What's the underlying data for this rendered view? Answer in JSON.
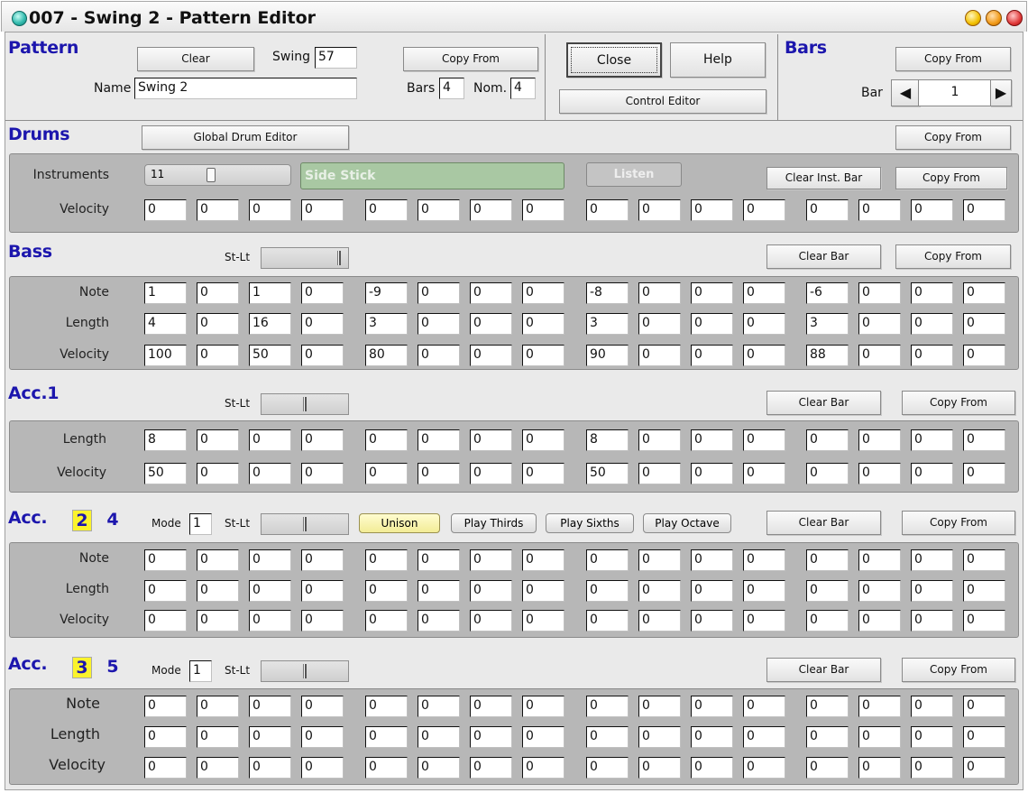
{
  "window": {
    "title": "007 - Swing 2 - Pattern Editor"
  },
  "pattern": {
    "heading": "Pattern",
    "clear": "Clear",
    "swing_label": "Swing",
    "swing_value": "57",
    "copy_from": "Copy From",
    "name_label": "Name",
    "name_value": "Swing 2",
    "bars_label": "Bars",
    "bars_value": "4",
    "nom_label": "Nom.",
    "nom_value": "4"
  },
  "controls": {
    "close": "Close",
    "help": "Help",
    "control_editor": "Control Editor"
  },
  "bars": {
    "heading": "Bars",
    "copy_from": "Copy From",
    "bar_label": "Bar",
    "bar_value": "1"
  },
  "drums": {
    "heading": "Drums",
    "global": "Global Drum Editor",
    "copy_from": "Copy From",
    "instruments_label": "Instruments",
    "instrument_num": "11",
    "instrument_name": "Side Stick",
    "listen": "Listen",
    "clear_inst": "Clear Inst. Bar",
    "copy_from2": "Copy From",
    "velocity_label": "Velocity",
    "velocity": [
      "0",
      "0",
      "0",
      "0",
      "0",
      "0",
      "0",
      "0",
      "0",
      "0",
      "0",
      "0",
      "0",
      "0",
      "0",
      "0"
    ]
  },
  "bass": {
    "heading": "Bass",
    "stlt": "St-Lt",
    "clear_bar": "Clear Bar",
    "copy_from": "Copy From",
    "note_label": "Note",
    "length_label": "Length",
    "velocity_label": "Velocity",
    "note": [
      "1",
      "0",
      "1",
      "0",
      "-9",
      "0",
      "0",
      "0",
      "-8",
      "0",
      "0",
      "0",
      "-6",
      "0",
      "0",
      "0"
    ],
    "length": [
      "4",
      "0",
      "16",
      "0",
      "3",
      "0",
      "0",
      "0",
      "3",
      "0",
      "0",
      "0",
      "3",
      "0",
      "0",
      "0"
    ],
    "velocity": [
      "100",
      "0",
      "50",
      "0",
      "80",
      "0",
      "0",
      "0",
      "90",
      "0",
      "0",
      "0",
      "88",
      "0",
      "0",
      "0"
    ]
  },
  "acc1": {
    "heading": "Acc.1",
    "stlt": "St-Lt",
    "clear_bar": "Clear Bar",
    "copy_from": "Copy From",
    "length_label": "Length",
    "velocity_label": "Velocity",
    "length": [
      "8",
      "0",
      "0",
      "0",
      "0",
      "0",
      "0",
      "0",
      "8",
      "0",
      "0",
      "0",
      "0",
      "0",
      "0",
      "0"
    ],
    "velocity": [
      "50",
      "0",
      "0",
      "0",
      "0",
      "0",
      "0",
      "0",
      "50",
      "0",
      "0",
      "0",
      "0",
      "0",
      "0",
      "0"
    ]
  },
  "acc24": {
    "heading": "Acc.",
    "num_a": "2",
    "num_b": "4",
    "mode_label": "Mode",
    "mode_value": "1",
    "stlt": "St-Lt",
    "unison": "Unison",
    "thirds": "Play Thirds",
    "sixths": "Play Sixths",
    "octave": "Play Octave",
    "clear_bar": "Clear Bar",
    "copy_from": "Copy From",
    "note_label": "Note",
    "length_label": "Length",
    "velocity_label": "Velocity",
    "note": [
      "0",
      "0",
      "0",
      "0",
      "0",
      "0",
      "0",
      "0",
      "0",
      "0",
      "0",
      "0",
      "0",
      "0",
      "0",
      "0"
    ],
    "length": [
      "0",
      "0",
      "0",
      "0",
      "0",
      "0",
      "0",
      "0",
      "0",
      "0",
      "0",
      "0",
      "0",
      "0",
      "0",
      "0"
    ],
    "velocity": [
      "0",
      "0",
      "0",
      "0",
      "0",
      "0",
      "0",
      "0",
      "0",
      "0",
      "0",
      "0",
      "0",
      "0",
      "0",
      "0"
    ]
  },
  "acc35": {
    "heading": "Acc.",
    "num_a": "3",
    "num_b": "5",
    "mode_label": "Mode",
    "mode_value": "1",
    "stlt": "St-Lt",
    "clear_bar": "Clear Bar",
    "copy_from": "Copy From",
    "note_label": "Note",
    "length_label": "Length",
    "velocity_label": "Velocity",
    "note": [
      "0",
      "0",
      "0",
      "0",
      "0",
      "0",
      "0",
      "0",
      "0",
      "0",
      "0",
      "0",
      "0",
      "0",
      "0",
      "0"
    ],
    "length": [
      "0",
      "0",
      "0",
      "0",
      "0",
      "0",
      "0",
      "0",
      "0",
      "0",
      "0",
      "0",
      "0",
      "0",
      "0",
      "0"
    ],
    "velocity": [
      "0",
      "0",
      "0",
      "0",
      "0",
      "0",
      "0",
      "0",
      "0",
      "0",
      "0",
      "0",
      "0",
      "0",
      "0",
      "0"
    ]
  }
}
